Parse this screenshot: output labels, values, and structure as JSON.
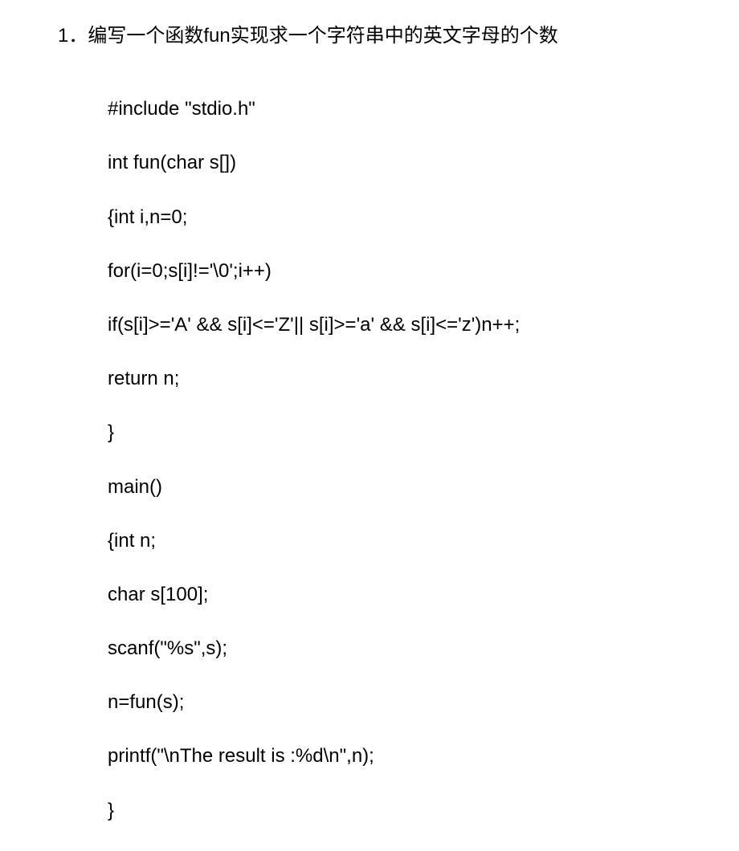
{
  "title": "1．编写一个函数fun实现求一个字符串中的英文字母的个数",
  "code": {
    "line1": "#include \"stdio.h\"",
    "line2": "int fun(char s[])",
    "line3": "{int i,n=0;",
    "line4": "for(i=0;s[i]!='\\0';i++)",
    "line5": "if(s[i]>='A' && s[i]<='Z'|| s[i]>='a' && s[i]<='z')n++;",
    "line6": "return n;",
    "line7": "}",
    "line8": "main()",
    "line9": "{int n;",
    "line10": "char s[100];",
    "line11": "scanf(\"%s\",s);",
    "line12": "n=fun(s);",
    "line13": "printf(\"\\nThe result is :%d\\n\",n);",
    "line14": "}"
  }
}
